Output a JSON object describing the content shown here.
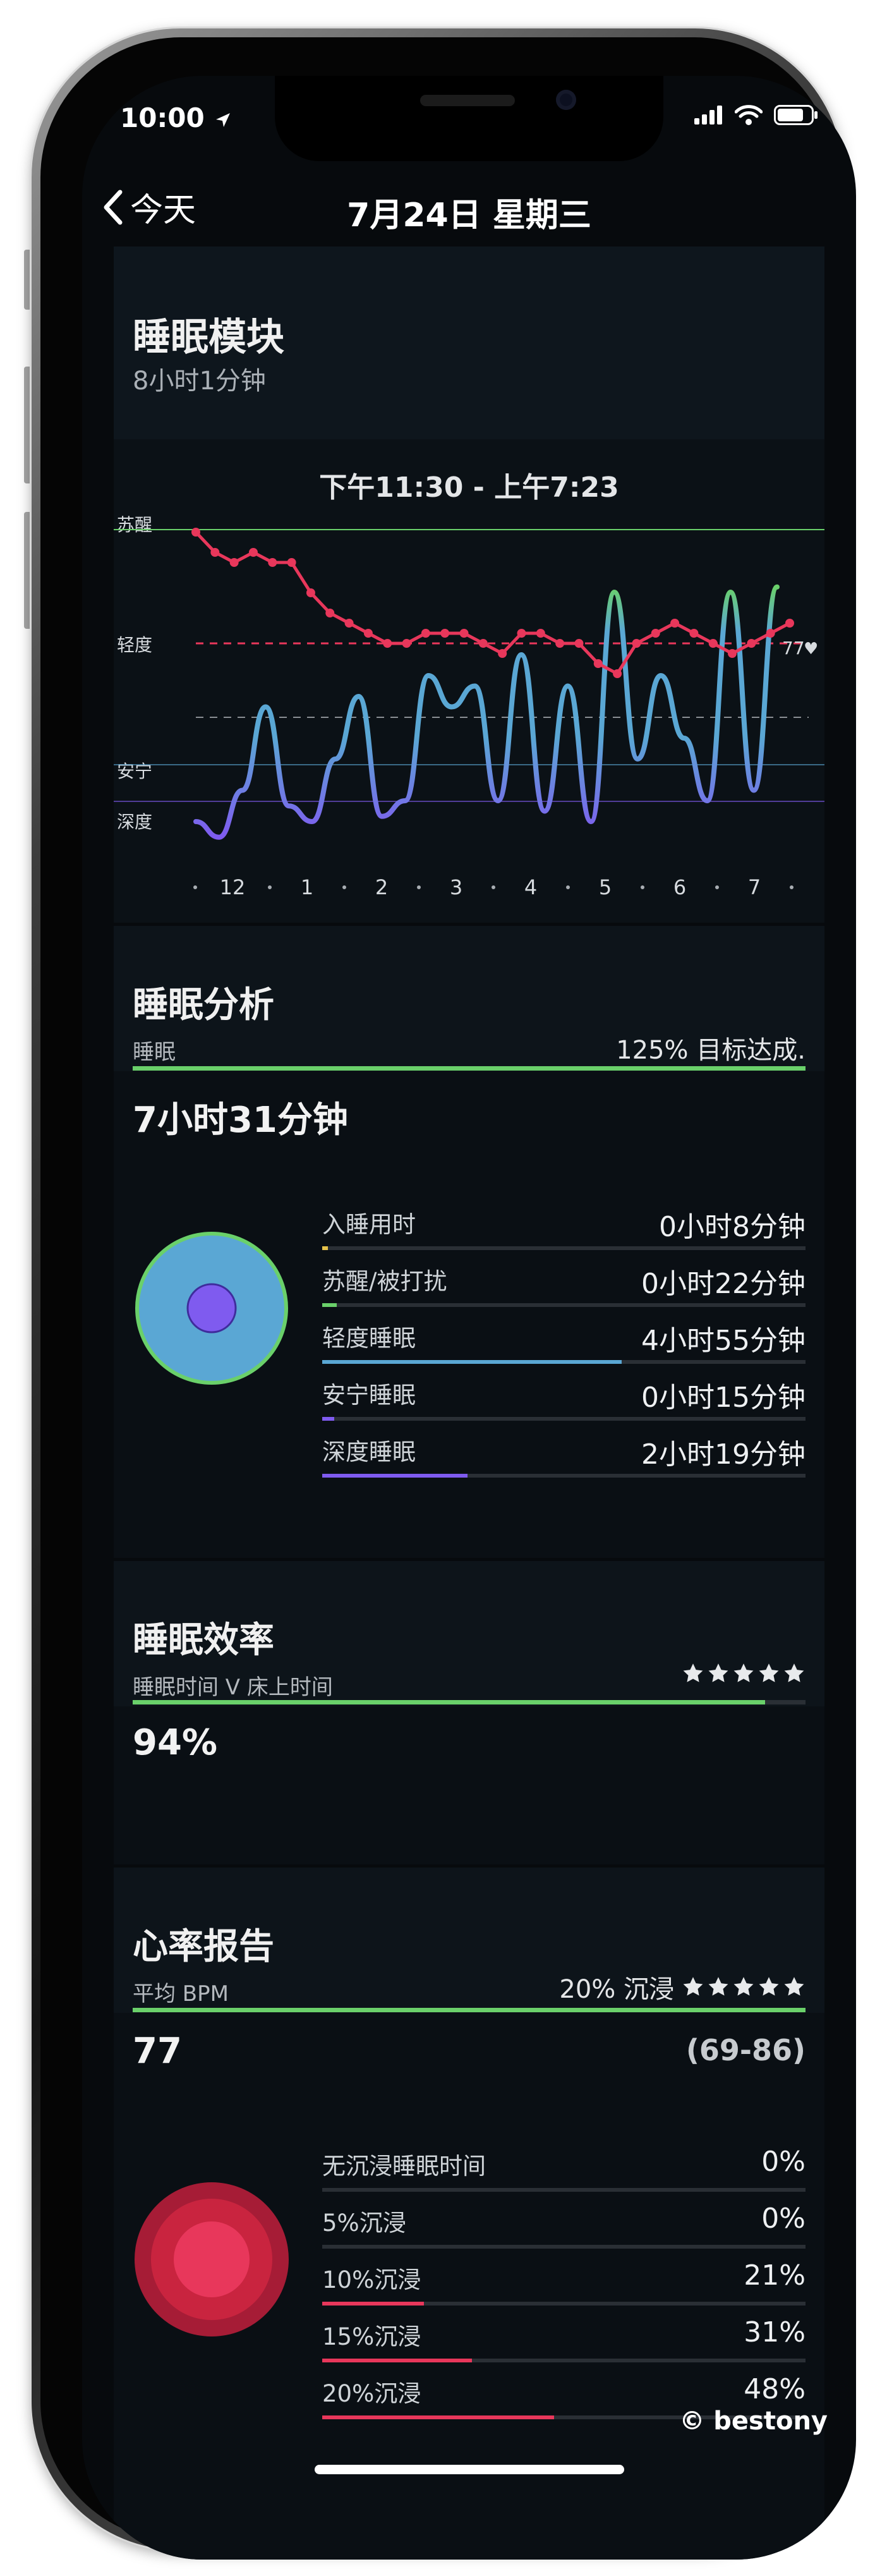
{
  "status_bar": {
    "time": "10:00"
  },
  "nav": {
    "back_label": "今天",
    "title": "7月24日 星期三"
  },
  "sleep_module": {
    "title": "睡眠模块",
    "duration": "8小时1分钟",
    "time_range": "下午11:30 - 上午7:23",
    "stage_labels": [
      "苏醒",
      "轻度",
      "安宁",
      "深度"
    ],
    "hr_end_label": "77",
    "x_ticks": [
      "12",
      "1",
      "2",
      "3",
      "4",
      "5",
      "6",
      "7"
    ],
    "colors": {
      "awake": "#6ad06a",
      "light": "#5aa7d4",
      "deep": "#7f5bef",
      "heart": "#e8375b"
    }
  },
  "chart_data": {
    "type": "line",
    "x_ticks": [
      "12",
      "1",
      "2",
      "3",
      "4",
      "5",
      "6",
      "7"
    ],
    "y_categories": [
      "深度",
      "安宁",
      "轻度",
      "苏醒"
    ],
    "series": [
      {
        "values": [
          1.0,
          0.85,
          1.3,
          2.1,
          1.15,
          1.0,
          1.6,
          2.2,
          1.05,
          1.2,
          2.4,
          2.1,
          2.3,
          1.2,
          2.6,
          1.1,
          2.3,
          1.0,
          3.2,
          1.6,
          2.4,
          1.8,
          1.2,
          3.2,
          1.3,
          3.25
        ]
      },
      {
        "values": [
          90,
          88,
          87,
          88,
          87,
          87,
          84,
          82,
          81,
          80,
          79,
          79,
          80,
          80,
          80,
          79,
          78,
          80,
          80,
          79,
          79,
          77,
          76,
          79,
          80,
          81,
          80,
          79,
          78,
          79,
          80,
          81
        ]
      }
    ]
  },
  "analysis": {
    "title": "睡眠分析",
    "metric": "睡眠",
    "goal_text": "125% 目标达成.",
    "total": "7小时31分钟",
    "rows": [
      {
        "label": "入睡用时",
        "value": "0小时8分钟",
        "fraction": 0.012,
        "color": "#e6c24a"
      },
      {
        "label": "苏醒/被打扰",
        "value": "0小时22分钟",
        "fraction": 0.03,
        "color": "#6ad06a"
      },
      {
        "label": "轻度睡眠",
        "value": "4小时55分钟",
        "fraction": 0.62,
        "color": "#5aa7d4"
      },
      {
        "label": "安宁睡眠",
        "value": "0小时15分钟",
        "fraction": 0.025,
        "color": "#7f5bef"
      },
      {
        "label": "深度睡眠",
        "value": "2小时19分钟",
        "fraction": 0.3,
        "color": "#7f5bef"
      }
    ]
  },
  "efficiency": {
    "title": "睡眠效率",
    "subtitle": "睡眠时间 V 床上时间",
    "value": "94%",
    "progress": 0.94,
    "stars": 5
  },
  "heart": {
    "title": "心率报告",
    "subtitle": "平均 BPM",
    "immersion": "20% 沉浸",
    "stars": 5,
    "avg": "77",
    "range": "(69-86)",
    "rows": [
      {
        "label": "无沉浸睡眠时间",
        "value": "0%",
        "fraction": 0
      },
      {
        "label": "5%沉浸",
        "value": "0%",
        "fraction": 0
      },
      {
        "label": "10%沉浸",
        "value": "21%",
        "fraction": 0.21
      },
      {
        "label": "15%沉浸",
        "value": "31%",
        "fraction": 0.31
      },
      {
        "label": "20%沉浸",
        "value": "48%",
        "fraction": 0.48
      }
    ]
  },
  "credit": "© bestony"
}
